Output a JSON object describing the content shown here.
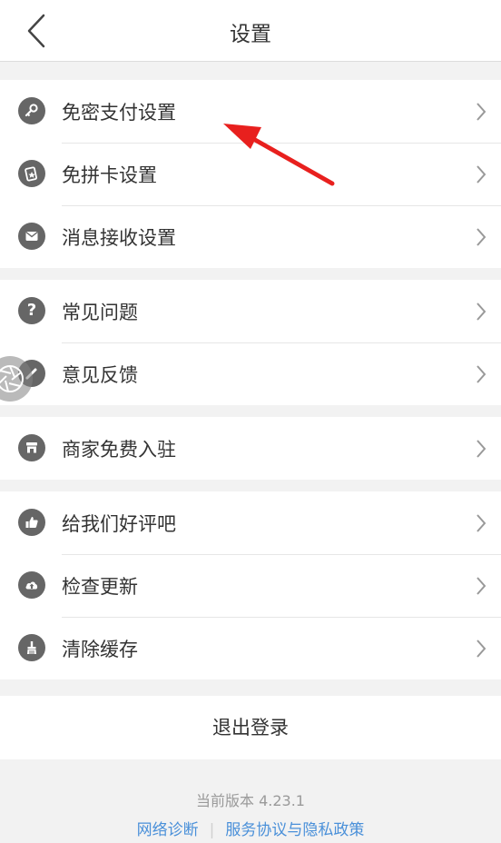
{
  "header": {
    "title": "设置"
  },
  "groups": [
    {
      "items": [
        {
          "label": "免密支付设置",
          "icon": "key-icon"
        },
        {
          "label": "免拼卡设置",
          "icon": "card-icon"
        },
        {
          "label": "消息接收设置",
          "icon": "mail-icon"
        }
      ]
    },
    {
      "items": [
        {
          "label": "常见问题",
          "icon": "question-icon"
        },
        {
          "label": "意见反馈",
          "icon": "pencil-icon"
        }
      ]
    },
    {
      "items": [
        {
          "label": "商家免费入驻",
          "icon": "store-icon"
        }
      ]
    },
    {
      "items": [
        {
          "label": "给我们好评吧",
          "icon": "thumbs-up-icon"
        },
        {
          "label": "检查更新",
          "icon": "cloud-upload-icon"
        },
        {
          "label": "清除缓存",
          "icon": "broom-icon"
        }
      ]
    }
  ],
  "logout": {
    "label": "退出登录"
  },
  "footer": {
    "version": "当前版本 4.23.1",
    "network_link": "网络诊断",
    "policy_link": "服务协议与隐私政策"
  },
  "colors": {
    "accent_link": "#4a90d9",
    "icon_bg": "#666666",
    "annotation": "#e8201e"
  }
}
